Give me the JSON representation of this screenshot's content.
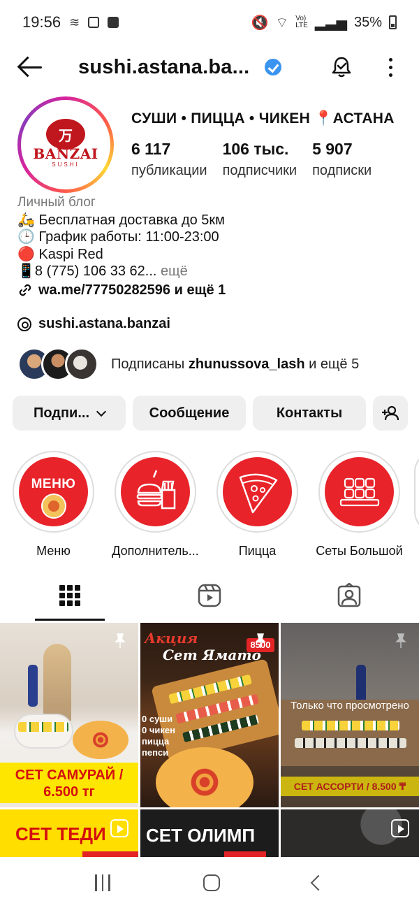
{
  "status_bar": {
    "time": "19:56",
    "battery": "35%"
  },
  "header": {
    "username": "sushi.astana.ba...",
    "icons": [
      "back-arrow-icon",
      "verified-badge-icon",
      "notification-bell-icon",
      "more-options-icon"
    ]
  },
  "profile": {
    "avatar_logo_text": "BANZAI",
    "avatar_logo_sub": "SUSHI",
    "display_name": "СУШИ • ПИЦЦА • ЧИКЕН 📍АСТАНА",
    "stats": [
      {
        "value": "6 117",
        "label": "публикации"
      },
      {
        "value": "106 тыс.",
        "label": "подписчики"
      },
      {
        "value": "5 907",
        "label": "подписки"
      }
    ],
    "category": "Личный блог",
    "bio_lines": [
      "🛵 Бесплатная доставка до 5км",
      "🕒 График работы: 11:00-23:00",
      "🔴 Kaspi Red"
    ],
    "phone_line": "📱8 (775) 106 33 62...",
    "more_label": " ещё",
    "link": "wa.me/77750282596 и ещё 1",
    "threads_handle": "sushi.astana.banzai",
    "followed_prefix": "Подписаны ",
    "followed_name": "zhunussova_lash",
    "followed_suffix": " и ещё 5"
  },
  "buttons": {
    "follow": "Подпи...",
    "message": "Сообщение",
    "contacts": "Контакты"
  },
  "highlights": [
    {
      "label": "Меню",
      "inner_text": "МЕНЮ"
    },
    {
      "label": "Дополнитель..."
    },
    {
      "label": "Пицца"
    },
    {
      "label": "Сеты Большой"
    }
  ],
  "tabs": [
    "grid-icon",
    "reels-icon",
    "tagged-icon"
  ],
  "posts": [
    {
      "caption": "СЕТ САМУРАЙ / 6.500 тг",
      "pinned": true
    },
    {
      "title_line1": "Акция",
      "title_line2": "Сет Ямато",
      "price_tag": "8500",
      "side_lines": [
        "0 суши",
        "0 чикен",
        "пицца",
        "пепси"
      ],
      "pinned": true
    },
    {
      "overlay": "Только что просмотрено",
      "caption": "СЕТ АССОРТИ / 8.500 ₸",
      "pinned": true
    },
    {
      "caption": "СЕТ ТЕДИ"
    },
    {
      "caption": "СЕТ ОЛИМП"
    },
    {
      "caption": ""
    }
  ]
}
